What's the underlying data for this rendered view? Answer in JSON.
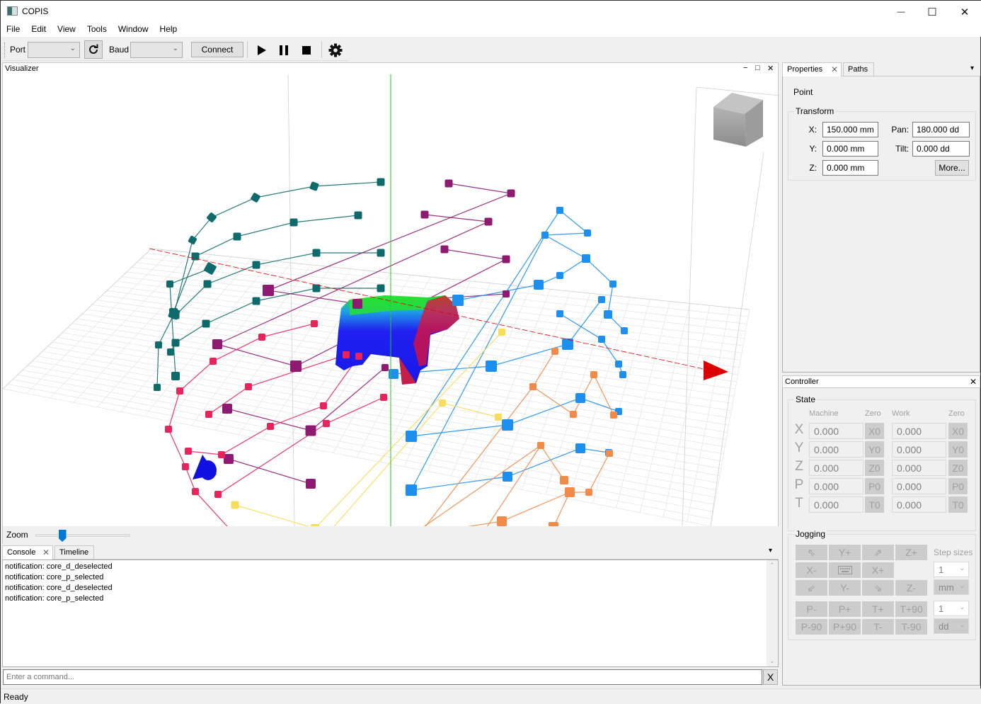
{
  "window": {
    "title": "COPIS",
    "controls": {
      "minimize": "—",
      "maximize": "☐",
      "close": "✕"
    }
  },
  "menu": [
    "File",
    "Edit",
    "View",
    "Tools",
    "Window",
    "Help"
  ],
  "toolbar": {
    "port_label": "Port",
    "port_value": "",
    "baud_label": "Baud",
    "baud_value": "",
    "connect_label": "Connect",
    "icons": [
      "refresh-icon",
      "play-icon",
      "pause-icon",
      "stop-icon",
      "gear-icon"
    ]
  },
  "visualizer": {
    "title": "Visualizer",
    "pane_controls": {
      "minimize": "−",
      "restore": "□",
      "close": "✕"
    },
    "zoom_label": "Zoom",
    "zoom_level": 0.28,
    "colors": {
      "x_axis": "#e00000",
      "y_axis": "#1010e0",
      "z_axis": "#22cc22",
      "path_teal": "#0f6b6b",
      "path_purple": "#8e1a72",
      "path_pink": "#e8245a",
      "path_blue": "#1c8fef",
      "path_orange": "#f28a4a",
      "path_yellow": "#f7dd5a"
    }
  },
  "console": {
    "tabs": [
      {
        "label": "Console",
        "active": true,
        "closable": true
      },
      {
        "label": "Timeline",
        "active": false,
        "closable": false
      }
    ],
    "lines": [
      "notification: core_d_deselected",
      "notification: core_p_selected",
      "notification: core_d_deselected",
      "notification: core_p_selected"
    ],
    "input_placeholder": "Enter a command...",
    "clear_label": "X"
  },
  "status": {
    "text": "Ready"
  },
  "properties": {
    "tabs": [
      {
        "label": "Properties",
        "active": true,
        "closable": true
      },
      {
        "label": "Paths",
        "active": false,
        "closable": false
      }
    ],
    "object_type": "Point",
    "transform_title": "Transform",
    "fields": {
      "x": {
        "label": "X:",
        "value": "150.000 mm"
      },
      "y": {
        "label": "Y:",
        "value": "0.000 mm"
      },
      "z": {
        "label": "Z:",
        "value": "0.000 mm"
      },
      "pan": {
        "label": "Pan:",
        "value": "180.000 dd"
      },
      "tilt": {
        "label": "Tilt:",
        "value": "0.000 dd"
      }
    },
    "more_label": "More..."
  },
  "controller": {
    "title": "Controller",
    "state_title": "State",
    "headers": {
      "machine": "Machine",
      "zero1": "Zero",
      "work": "Work",
      "zero2": "Zero"
    },
    "axes": [
      {
        "axis": "X",
        "machine": "0.000",
        "zero_machine": "X0",
        "work": "0.000",
        "zero_work": "X0"
      },
      {
        "axis": "Y",
        "machine": "0.000",
        "zero_machine": "Y0",
        "work": "0.000",
        "zero_work": "Y0"
      },
      {
        "axis": "Z",
        "machine": "0.000",
        "zero_machine": "Z0",
        "work": "0.000",
        "zero_work": "Z0"
      },
      {
        "axis": "P",
        "machine": "0.000",
        "zero_machine": "P0",
        "work": "0.000",
        "zero_work": "P0"
      },
      {
        "axis": "T",
        "machine": "0.000",
        "zero_machine": "T0",
        "work": "0.000",
        "zero_work": "T0"
      }
    ],
    "jogging": {
      "title": "Jogging",
      "step_sizes_label": "Step sizes",
      "rows": [
        [
          "⇖",
          "Y+",
          "⇗",
          "Z+"
        ],
        [
          "X-",
          "keyboard",
          "X+",
          ""
        ],
        [
          "⇙",
          "Y-",
          "⇘",
          "Z-"
        ],
        [
          "P-",
          "P+",
          "T+",
          "T+90"
        ],
        [
          "P-90",
          "P+90",
          "T-",
          "T-90"
        ]
      ],
      "linear_step": "1",
      "linear_unit": "mm",
      "angular_step": "1",
      "angular_unit": "dd"
    }
  }
}
